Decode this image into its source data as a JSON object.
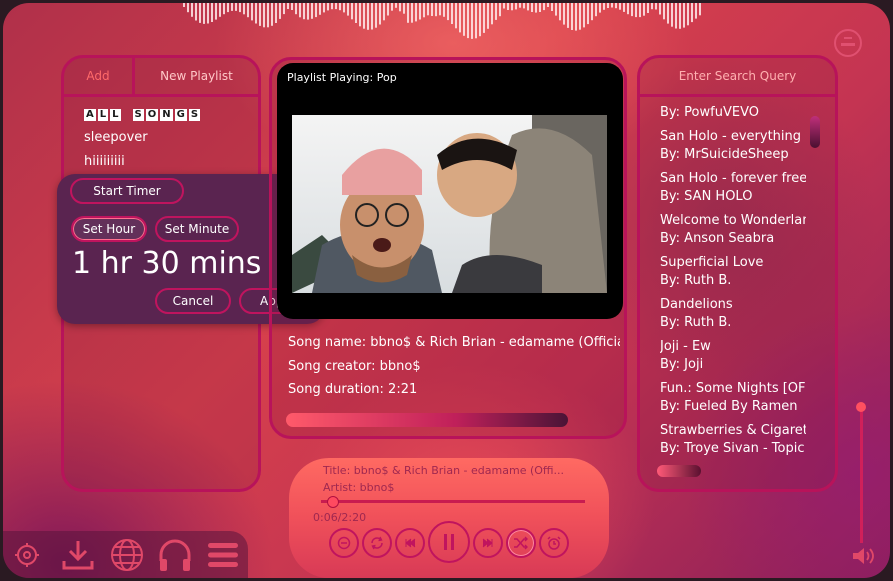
{
  "left_panel": {
    "tab_add": "Add",
    "tab_new_playlist": "New Playlist",
    "playlists": [
      "sleepover",
      "hiiiiiiiii"
    ],
    "all_songs_letters": [
      "A",
      "L",
      "L",
      " ",
      "S",
      "O",
      "N",
      "G",
      "S"
    ]
  },
  "timer": {
    "start_label": "Start Timer",
    "set_hour_label": "Set Hour",
    "set_minute_label": "Set Minute",
    "value": "1 hr 30 mins",
    "cancel_label": "Cancel",
    "apply_label": "Apply"
  },
  "video": {
    "playlist_label": "Playlist Playing: Pop"
  },
  "song_info": {
    "name": "Song name: bbno$ & Rich Brian - edamame (Official",
    "creator": "Song creator: bbno$",
    "duration": "Song duration: 2:21"
  },
  "search": {
    "placeholder": "Enter Search Query"
  },
  "songs": [
    {
      "title": "",
      "by": "By: PowfuVEVO"
    },
    {
      "title": "San Holo - everything m",
      "by": "By: MrSuicideSheep"
    },
    {
      "title": "San Holo - forever free",
      "by": "By: SAN HOLO"
    },
    {
      "title": "Welcome to Wonderlan",
      "by": "By: Anson Seabra"
    },
    {
      "title": "Superficial Love",
      "by": "By: Ruth B."
    },
    {
      "title": "Dandelions",
      "by": "By: Ruth B."
    },
    {
      "title": "Joji - Ew",
      "by": "By: Joji"
    },
    {
      "title": "Fun.: Some Nights [OFF",
      "by": "By: Fueled By Ramen"
    },
    {
      "title": "Strawberries & Cigaret",
      "by": "By: Troye Sivan - Topic"
    }
  ],
  "player": {
    "title": "Title: bbno$ & Rich Brian - edamame (Offi...",
    "artist": "Artist: bbno$",
    "time": "0:06/2:20",
    "progress": 0.043
  },
  "colors": {
    "accent": "#c0145e",
    "bg": "#d6404c"
  }
}
